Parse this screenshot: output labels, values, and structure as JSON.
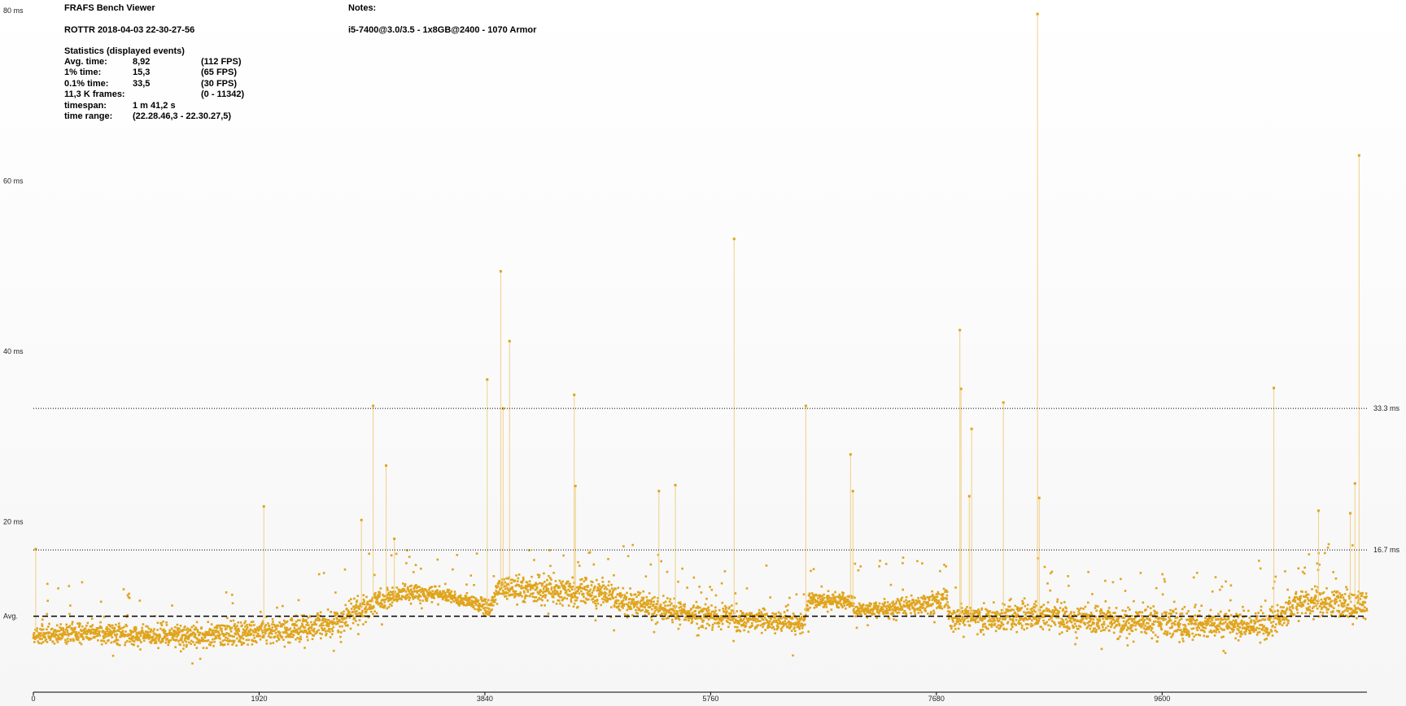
{
  "app": {
    "title": "FRAFS Bench Viewer",
    "bench_name": "ROTTR 2018-04-03 22-30-27-56",
    "notes_label": "Notes:",
    "notes_text": "i5-7400@3.0/3.5 - 1x8GB@2400 - 1070 Armor"
  },
  "stats": {
    "heading": "Statistics (displayed events)",
    "rows": [
      {
        "label": "Avg. time:",
        "value": "8,92",
        "fps": "(112 FPS)"
      },
      {
        "label": "1% time:",
        "value": "15,3",
        "fps": "(65 FPS)"
      },
      {
        "label": "0.1% time:",
        "value": "33,5",
        "fps": "(30 FPS)"
      },
      {
        "label": "11,3 K frames:",
        "value": "",
        "fps": "(0 - 11342)"
      },
      {
        "label": "timespan:",
        "value": "1 m 41,2 s",
        "fps": ""
      },
      {
        "label": "time range:",
        "value": "(22.28.46,3 - 22.30.27,5)",
        "fps": ""
      }
    ]
  },
  "colors": {
    "series": "#e0a41c",
    "spike": "#f1cf86",
    "reference_line": "#000000"
  },
  "chart_data": {
    "type": "scatter",
    "xlim": [
      0,
      11342
    ],
    "ylim": [
      0,
      80
    ],
    "x_ticks": [
      0,
      1920,
      3840,
      5760,
      7680,
      9600
    ],
    "y_ticks": [
      {
        "value": 20,
        "label": "20 ms"
      },
      {
        "value": 40,
        "label": "40 ms"
      },
      {
        "value": 60,
        "label": "60 ms"
      },
      {
        "value": 80,
        "label": "80 ms"
      }
    ],
    "reference_lines": [
      {
        "value": 33.3,
        "label": "33.3 ms",
        "style": "dotted"
      },
      {
        "value": 16.7,
        "label": "16.7 ms",
        "style": "dotted"
      },
      {
        "value": 8.92,
        "label": "Avg.",
        "style": "dashed"
      }
    ],
    "baseline_profile": [
      {
        "x": 0,
        "y": 6.6,
        "spread": 0.7
      },
      {
        "x": 500,
        "y": 7.0,
        "spread": 0.8
      },
      {
        "x": 1000,
        "y": 6.6,
        "spread": 0.8
      },
      {
        "x": 1500,
        "y": 6.6,
        "spread": 0.9
      },
      {
        "x": 1920,
        "y": 7.0,
        "spread": 1.0
      },
      {
        "x": 2300,
        "y": 7.4,
        "spread": 1.1
      },
      {
        "x": 2650,
        "y": 8.6,
        "spread": 1.0
      },
      {
        "x": 2850,
        "y": 10.3,
        "spread": 1.0
      },
      {
        "x": 3150,
        "y": 11.6,
        "spread": 0.7
      },
      {
        "x": 3450,
        "y": 11.5,
        "spread": 0.6
      },
      {
        "x": 3650,
        "y": 10.8,
        "spread": 0.5
      },
      {
        "x": 3880,
        "y": 9.8,
        "spread": 0.8
      },
      {
        "x": 3950,
        "y": 12.2,
        "spread": 0.9
      },
      {
        "x": 4400,
        "y": 12.1,
        "spread": 1.0
      },
      {
        "x": 4800,
        "y": 11.6,
        "spread": 1.1
      },
      {
        "x": 5400,
        "y": 9.4,
        "spread": 0.9
      },
      {
        "x": 6000,
        "y": 8.7,
        "spread": 0.9
      },
      {
        "x": 6550,
        "y": 8.1,
        "spread": 0.8
      },
      {
        "x": 6600,
        "y": 10.8,
        "spread": 0.7
      },
      {
        "x": 6950,
        "y": 10.6,
        "spread": 0.7
      },
      {
        "x": 7000,
        "y": 9.6,
        "spread": 0.6
      },
      {
        "x": 7300,
        "y": 9.8,
        "spread": 0.7
      },
      {
        "x": 7770,
        "y": 10.9,
        "spread": 0.8
      },
      {
        "x": 7800,
        "y": 8.7,
        "spread": 1.0
      },
      {
        "x": 8500,
        "y": 8.8,
        "spread": 1.1
      },
      {
        "x": 9500,
        "y": 8.1,
        "spread": 1.1
      },
      {
        "x": 10500,
        "y": 7.8,
        "spread": 1.2
      },
      {
        "x": 10800,
        "y": 10.8,
        "spread": 1.2
      },
      {
        "x": 11342,
        "y": 10.3,
        "spread": 1.1
      }
    ],
    "spikes": [
      {
        "x": 20,
        "y": 16.8
      },
      {
        "x": 1960,
        "y": 21.8
      },
      {
        "x": 2790,
        "y": 20.2
      },
      {
        "x": 2890,
        "y": 33.6
      },
      {
        "x": 3000,
        "y": 26.6
      },
      {
        "x": 3070,
        "y": 18.0
      },
      {
        "x": 3860,
        "y": 36.7
      },
      {
        "x": 3975,
        "y": 49.4
      },
      {
        "x": 3995,
        "y": 33.3
      },
      {
        "x": 4050,
        "y": 41.2
      },
      {
        "x": 4600,
        "y": 34.9
      },
      {
        "x": 4610,
        "y": 24.2
      },
      {
        "x": 5320,
        "y": 23.6
      },
      {
        "x": 5460,
        "y": 24.3
      },
      {
        "x": 5960,
        "y": 53.2
      },
      {
        "x": 6570,
        "y": 33.6
      },
      {
        "x": 6950,
        "y": 27.9
      },
      {
        "x": 6970,
        "y": 23.6
      },
      {
        "x": 7880,
        "y": 42.5
      },
      {
        "x": 7890,
        "y": 35.6
      },
      {
        "x": 7980,
        "y": 30.9
      },
      {
        "x": 8250,
        "y": 34.0
      },
      {
        "x": 8540,
        "y": 79.6
      },
      {
        "x": 8555,
        "y": 22.8
      },
      {
        "x": 10550,
        "y": 35.7
      },
      {
        "x": 10930,
        "y": 21.3
      },
      {
        "x": 11240,
        "y": 24.5
      },
      {
        "x": 11275,
        "y": 63.0
      },
      {
        "x": 11200,
        "y": 21.0
      },
      {
        "x": 7960,
        "y": 23.0
      }
    ]
  }
}
